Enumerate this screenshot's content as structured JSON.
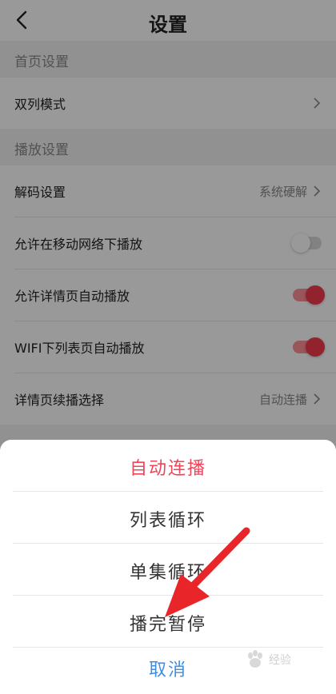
{
  "header": {
    "title": "设置"
  },
  "sections": {
    "home": {
      "title": "首页设置"
    },
    "playback": {
      "title": "播放设置"
    }
  },
  "rows": {
    "double_column": {
      "label": "双列模式"
    },
    "decoder": {
      "label": "解码设置",
      "value": "系统硬解"
    },
    "mobile_network": {
      "label": "允许在移动网络下播放",
      "enabled": false
    },
    "detail_autoplay": {
      "label": "允许详情页自动播放",
      "enabled": true
    },
    "wifi_list_autoplay": {
      "label": "WIFI下列表页自动播放",
      "enabled": true
    },
    "continuous": {
      "label": "详情页续播选择",
      "value": "自动连播"
    }
  },
  "sheet": {
    "options": [
      "自动连播",
      "列表循环",
      "单集循环",
      "播完暂停"
    ],
    "selected": "自动连播",
    "cancel_label": "取消"
  },
  "colors": {
    "accent": "#f04458",
    "toggle_on": "#f43a4c",
    "cancel": "#3d8ee6",
    "annotation_arrow": "#e8262a"
  },
  "annotation": {
    "arrow_target": "播完暂停"
  },
  "watermark": {
    "text": "经验"
  }
}
